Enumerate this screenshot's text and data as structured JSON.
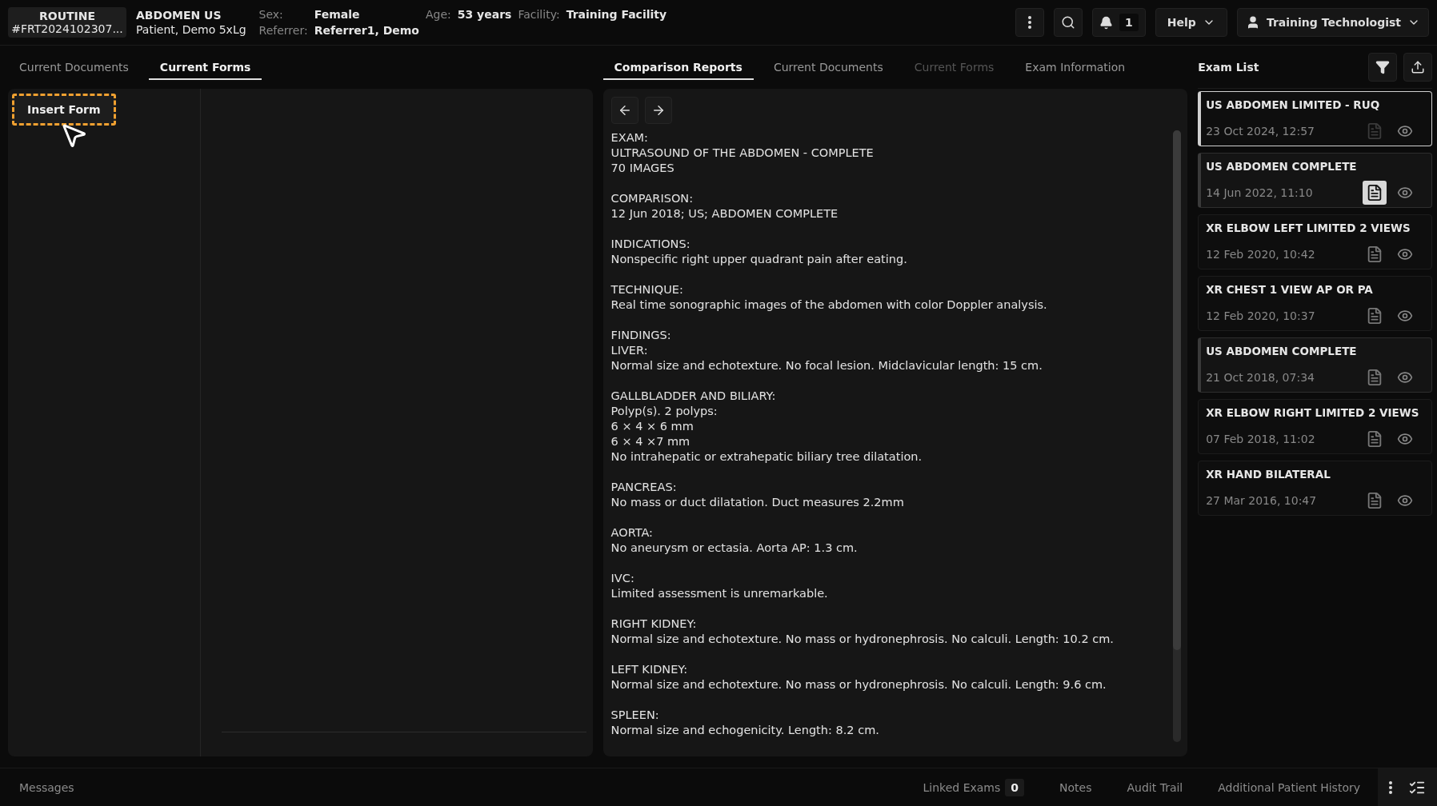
{
  "header": {
    "priority": "ROUTINE",
    "accession": "#FRT2024102307...",
    "exam": "ABDOMEN US",
    "patient": "Patient, Demo 5xLg",
    "fields": [
      {
        "label": "Sex:",
        "value": "Female"
      },
      {
        "label": "Age:",
        "value": "53 years"
      },
      {
        "label": "Facility:",
        "value": "Training Facility"
      },
      {
        "label": "Referrer:",
        "value": "Referrer1, Demo"
      }
    ],
    "notifications": "1",
    "help": "Help",
    "user": "Training Technologist"
  },
  "left_tabs": [
    {
      "label": "Current Documents",
      "selected": false
    },
    {
      "label": "Current Forms",
      "selected": true
    }
  ],
  "insert_form": "Insert Form",
  "center_tabs": [
    {
      "label": "Comparison Reports",
      "selected": true,
      "disabled": false
    },
    {
      "label": "Current Documents",
      "selected": false,
      "disabled": false
    },
    {
      "label": "Current Forms",
      "selected": false,
      "disabled": true
    },
    {
      "label": "Exam Information",
      "selected": false,
      "disabled": false
    }
  ],
  "report": [
    {
      "heading": "EXAM:",
      "lines": [
        "ULTRASOUND OF THE ABDOMEN - COMPLETE",
        "70 IMAGES"
      ]
    },
    {
      "heading": "COMPARISON:",
      "lines": [
        "12 Jun 2018; US; ABDOMEN COMPLETE"
      ]
    },
    {
      "heading": "INDICATIONS:",
      "lines": [
        "Nonspecific right upper quadrant pain after eating."
      ]
    },
    {
      "heading": "TECHNIQUE:",
      "lines": [
        "Real time sonographic images of the abdomen with color Doppler analysis."
      ]
    },
    {
      "heading": "FINDINGS:",
      "lines": [
        "LIVER:",
        "Normal size and echotexture. No focal lesion. Midclavicular length: 15 cm."
      ]
    },
    {
      "heading": "GALLBLADDER AND BILIARY:",
      "lines": [
        "Polyp(s). 2 polyps:",
        "6 × 4 × 6 mm",
        "6 × 4 ×7 mm",
        "No intrahepatic or extrahepatic biliary tree dilatation."
      ]
    },
    {
      "heading": "PANCREAS:",
      "lines": [
        "No mass or duct dilatation. Duct measures 2.2mm"
      ]
    },
    {
      "heading": "AORTA:",
      "lines": [
        "No aneurysm or ectasia. Aorta AP: 1.3 cm."
      ]
    },
    {
      "heading": "IVC:",
      "lines": [
        "Limited assessment is unremarkable."
      ]
    },
    {
      "heading": "RIGHT KIDNEY:",
      "lines": [
        "Normal size and echotexture. No mass or hydronephrosis. No calculi. Length: 10.2 cm."
      ]
    },
    {
      "heading": "LEFT KIDNEY:",
      "lines": [
        "Normal size and echotexture. No mass or hydronephrosis. No calculi. Length: 9.6 cm."
      ]
    },
    {
      "heading": "SPLEEN:",
      "lines": [
        "Normal size and echogenicity. Length: 8.2 cm."
      ]
    }
  ],
  "exam_list": {
    "title": "Exam List",
    "exams": [
      {
        "name": "US ABDOMEN LIMITED - RUQ",
        "date": "23 Oct 2024, 12:57",
        "selected": true,
        "marked": false,
        "report_open": false,
        "report_disabled": true
      },
      {
        "name": "US ABDOMEN COMPLETE",
        "date": "14 Jun 2022, 11:10",
        "selected": false,
        "marked": true,
        "report_open": true,
        "report_disabled": false
      },
      {
        "name": "XR ELBOW LEFT LIMITED 2 VIEWS",
        "date": "12 Feb 2020, 10:42",
        "selected": false,
        "marked": false,
        "report_open": false,
        "report_disabled": false
      },
      {
        "name": "XR CHEST 1 VIEW AP OR PA",
        "date": "12 Feb 2020, 10:37",
        "selected": false,
        "marked": false,
        "report_open": false,
        "report_disabled": false
      },
      {
        "name": "US ABDOMEN COMPLETE",
        "date": "21 Oct 2018, 07:34",
        "selected": false,
        "marked": true,
        "report_open": false,
        "report_disabled": false
      },
      {
        "name": "XR ELBOW RIGHT LIMITED 2 VIEWS",
        "date": "07 Feb 2018, 11:02",
        "selected": false,
        "marked": false,
        "report_open": false,
        "report_disabled": false
      },
      {
        "name": "XR HAND BILATERAL",
        "date": "27 Mar 2016, 10:47",
        "selected": false,
        "marked": false,
        "report_open": false,
        "report_disabled": false
      }
    ]
  },
  "footer": {
    "messages": "Messages",
    "linked_exams": "Linked Exams",
    "linked_count": "0",
    "links": [
      "Notes",
      "Audit Trail",
      "Additional Patient History"
    ]
  }
}
